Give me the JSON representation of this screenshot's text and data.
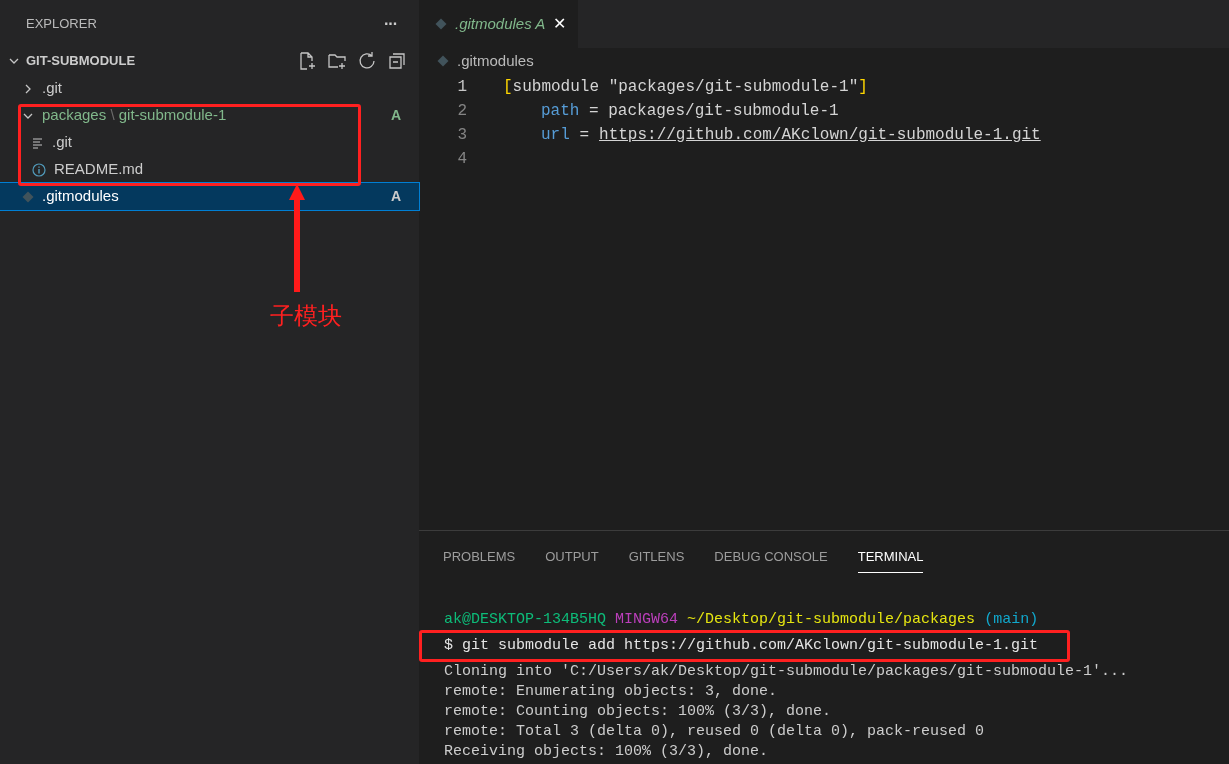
{
  "sidebar": {
    "title": "EXPLORER",
    "more": "···",
    "section": {
      "label": "GIT-SUBMODULE",
      "expanded": true
    },
    "tree": [
      {
        "kind": "folder",
        "label": ".git",
        "expanded": false,
        "selected": false
      },
      {
        "kind": "folder",
        "label": "packages",
        "separator": "\\",
        "label_tail": "git-submodule-1",
        "expanded": true,
        "selected": false,
        "badge": "A",
        "children": [
          {
            "kind": "text",
            "label": ".git",
            "selected": false
          },
          {
            "kind": "info",
            "label": "README.md",
            "selected": false
          }
        ]
      },
      {
        "kind": "git",
        "label": ".gitmodules",
        "selected": true,
        "badge": "A"
      }
    ]
  },
  "editor": {
    "tab": {
      "label": ".gitmodules",
      "badge": "A",
      "close": "✕"
    },
    "breadcrumb": ".gitmodules",
    "lines": [
      {
        "number": "1",
        "kind": "section",
        "open": "[",
        "text": "submodule \"packages/git-submodule-1\"",
        "close": "]"
      },
      {
        "number": "2",
        "kind": "pair",
        "key": "path",
        "separator": "=",
        "value": "packages/git-submodule-1"
      },
      {
        "number": "3",
        "kind": "link",
        "key": "url",
        "separator": "=",
        "value": "https://github.com/AKclown/git-submodule-1.git"
      },
      {
        "number": "4",
        "kind": "empty"
      }
    ]
  },
  "panel": {
    "tabs": [
      {
        "label": "PROBLEMS",
        "selected": false
      },
      {
        "label": "OUTPUT",
        "selected": false
      },
      {
        "label": "GITLENS",
        "selected": false
      },
      {
        "label": "DEBUG CONSOLE",
        "selected": false
      },
      {
        "label": "TERMINAL",
        "selected": true
      }
    ],
    "prompt": {
      "user": "ak@DESKTOP-134B5HQ",
      "shell": "MINGW64",
      "path": "~/Desktop/git-submodule/packages",
      "branch": "(main)"
    },
    "command": "$ git submodule add https://github.com/AKclown/git-submodule-1.git",
    "output": [
      "Cloning into 'C:/Users/ak/Desktop/git-submodule/packages/git-submodule-1'...",
      "remote: Enumerating objects: 3, done.",
      "remote: Counting objects: 100% (3/3), done.",
      "remote: Total 3 (delta 0), reused 0 (delta 0), pack-reused 0",
      "Receiving objects: 100% (3/3), done."
    ]
  },
  "annotation": {
    "label": "子模块"
  }
}
